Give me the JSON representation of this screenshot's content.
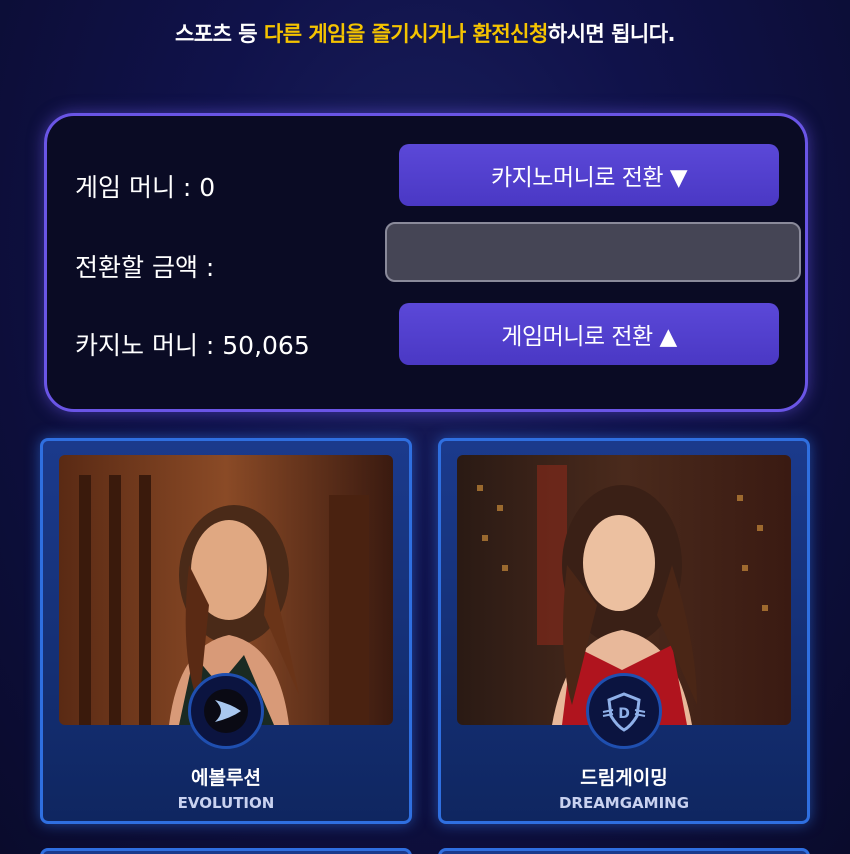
{
  "notice": {
    "part1": "스포츠 등 ",
    "highlight1": "다른 게임을 즐기시거나 환전신청",
    "part2": "하시면 됩니다."
  },
  "exchange": {
    "game_money_label": "게임 머니 : 0",
    "convert_amount_label": "전환할 금액 :",
    "casino_money_label": "카지노 머니 : 50,065",
    "to_casino_button": "카지노머니로 전환 ▼",
    "to_game_button": "게임머니로 전환 ▲",
    "amount_value": ""
  },
  "games": [
    {
      "name_ko": "에볼루션",
      "name_en": "EVOLUTION",
      "logo_icon": "evolution-logo-icon"
    },
    {
      "name_ko": "드림게이밍",
      "name_en": "DREAMGAMING",
      "logo_icon": "dreamgaming-logo-icon"
    }
  ],
  "colors": {
    "accent": "#5b48d8",
    "highlight": "#f5c400",
    "card_border": "#2f6fe0"
  }
}
